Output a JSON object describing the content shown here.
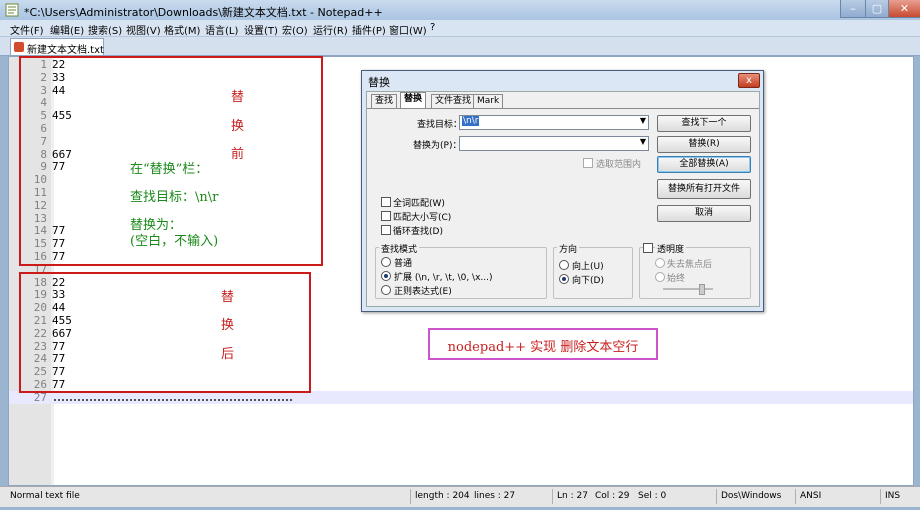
{
  "window": {
    "title": "*C:\\Users\\Administrator\\Downloads\\新建文本文档.txt - Notepad++",
    "controls": {
      "minimize": "–",
      "maximize": "▢",
      "close": "✕"
    }
  },
  "menu": [
    "文件(F)",
    "编辑(E)",
    "搜索(S)",
    "视图(V)",
    "格式(M)",
    "语言(L)",
    "设置(T)",
    "宏(O)",
    "运行(R)",
    "插件(P)",
    "窗口(W)",
    "?"
  ],
  "tab": {
    "label": "新建文本文档.txt"
  },
  "editor": {
    "lines": [
      {
        "num": "1",
        "text": "22"
      },
      {
        "num": "2",
        "text": "33"
      },
      {
        "num": "3",
        "text": "44"
      },
      {
        "num": "4",
        "text": ""
      },
      {
        "num": "5",
        "text": "455"
      },
      {
        "num": "6",
        "text": ""
      },
      {
        "num": "7",
        "text": ""
      },
      {
        "num": "8",
        "text": "667"
      },
      {
        "num": "9",
        "text": "77"
      },
      {
        "num": "10",
        "text": ""
      },
      {
        "num": "11",
        "text": ""
      },
      {
        "num": "12",
        "text": ""
      },
      {
        "num": "13",
        "text": ""
      },
      {
        "num": "14",
        "text": "77"
      },
      {
        "num": "15",
        "text": "77"
      },
      {
        "num": "16",
        "text": "77"
      },
      {
        "num": "17",
        "text": ""
      },
      {
        "num": "18",
        "text": "22"
      },
      {
        "num": "19",
        "text": "33"
      },
      {
        "num": "20",
        "text": "44"
      },
      {
        "num": "21",
        "text": "455"
      },
      {
        "num": "22",
        "text": "667"
      },
      {
        "num": "23",
        "text": "77"
      },
      {
        "num": "24",
        "text": "77"
      },
      {
        "num": "25",
        "text": "77"
      },
      {
        "num": "26",
        "text": "77"
      },
      {
        "num": "27",
        "text": ""
      }
    ],
    "colors": {
      "gutter": "#e4e4e4",
      "current_line": "#e8e8ff"
    }
  },
  "annotations": {
    "before": [
      "替",
      "换",
      "前"
    ],
    "after": [
      "替",
      "换",
      "后"
    ],
    "instructions": [
      "在“替换”栏：",
      "查找目标：\\n\\r",
      "替换为：",
      "(空白，不输入)"
    ],
    "caption": "nodepad++  实现 删除文本空行",
    "colors": {
      "red": "#c82020",
      "green": "#1a8a1a",
      "box": "#cc1a1a",
      "caption_box": "#cc55cc"
    }
  },
  "dialog": {
    "title": "替换",
    "close": "x",
    "tabs": [
      "查找",
      "替换",
      "文件查找",
      "Mark"
    ],
    "active_tab": "替换",
    "find_label": "查找目标：",
    "find_value": "\\n\\r",
    "replace_label": "替换为(P)：",
    "replace_value": "",
    "in_selection": "选取范围内",
    "buttons": [
      "查找下一个",
      "替换(R)",
      "全部替换(A)",
      "替换所有打开文件",
      "取消"
    ],
    "checkboxes": [
      "全词匹配(W)",
      "匹配大小写(C)",
      "循环查找(D)"
    ],
    "search_mode": {
      "title": "查找模式",
      "options": [
        "普通",
        "扩展 (\\n, \\r, \\t, \\0, \\x...)",
        "正则表达式(E)"
      ],
      "selected": "扩展 (\\n, \\r, \\t, \\0, \\x...)"
    },
    "direction": {
      "title": "方向",
      "options": [
        "向上(U)",
        "向下(D)"
      ],
      "selected": "向下(D)"
    },
    "transparency": {
      "title": "透明度",
      "options": [
        "失去焦点后",
        "始终"
      ]
    }
  },
  "status": {
    "file_type": "Normal text file",
    "length": "length : 204",
    "lines": "lines : 27",
    "ln": "Ln : 27",
    "col": "Col : 29",
    "sel": "Sel : 0",
    "eol": "Dos\\Windows",
    "encoding": "ANSI",
    "mode": "INS"
  }
}
